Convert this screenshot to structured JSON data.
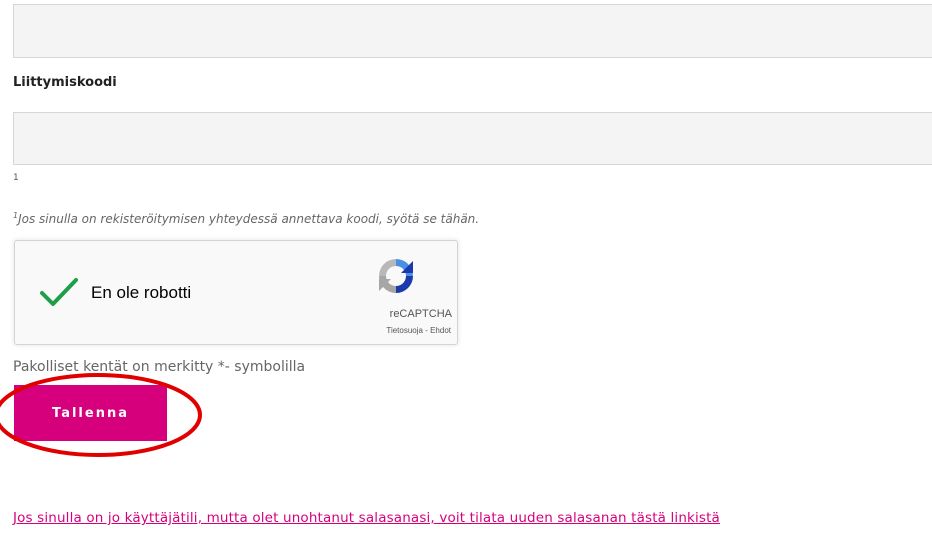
{
  "form": {
    "top_field_value": "",
    "code_label": "Liittymiskoodi",
    "code_value": "",
    "footnote_marker": "1",
    "hint_marker": "1",
    "hint_text": "Jos sinulla on rekisteröitymisen yhteydessä annettava koodi, syötä se tähän."
  },
  "recaptcha": {
    "label": "En ole robotti",
    "brand": "reCAPTCHA",
    "links": "Tietosuoja - Ehdot",
    "checked": true,
    "check_color": "#1e9e4a"
  },
  "required_note": "Pakolliset kentät on merkitty *- symbolilla",
  "save_button": {
    "label": "Tallenna",
    "color": "#d6007d"
  },
  "highlight_color": "#e00000",
  "reset_link": "Jos sinulla on jo käyttäjätili, mutta olet unohtanut salasanasi, voit tilata uuden salasanan tästä linkistä"
}
